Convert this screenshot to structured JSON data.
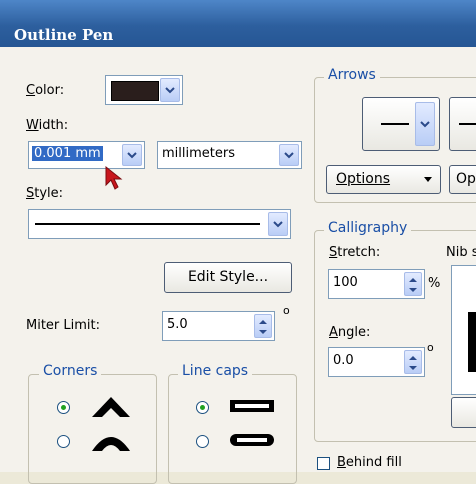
{
  "window": {
    "title": "Outline Pen"
  },
  "color": {
    "label": "Color:",
    "swatch": "#2a1e1c"
  },
  "width": {
    "label": "Width:",
    "value": "0.001 mm",
    "unit": "millimeters"
  },
  "style": {
    "label": "Style:"
  },
  "edit_style": {
    "label": "Edit Style..."
  },
  "miter": {
    "label": "Miter Limit:",
    "value": "5.0",
    "degree": "o"
  },
  "corners": {
    "legend": "Corners"
  },
  "line_caps": {
    "legend": "Line caps"
  },
  "arrows": {
    "legend": "Arrows",
    "options1": "Options",
    "options2": "Op"
  },
  "calligraphy": {
    "legend": "Calligraphy",
    "stretch_label": "Stretch:",
    "stretch_value": "100",
    "percent": "%",
    "nib_label": "Nib s",
    "angle_label": "Angle:",
    "angle_value": "0.0",
    "degree": "o"
  },
  "behind_fill": {
    "label": "Behind fill"
  },
  "colors": {
    "title_bar": "#2d5f9e",
    "accent_label": "#1a4fa6",
    "selection": "#316ac5",
    "radio_dot": "#21a121"
  }
}
